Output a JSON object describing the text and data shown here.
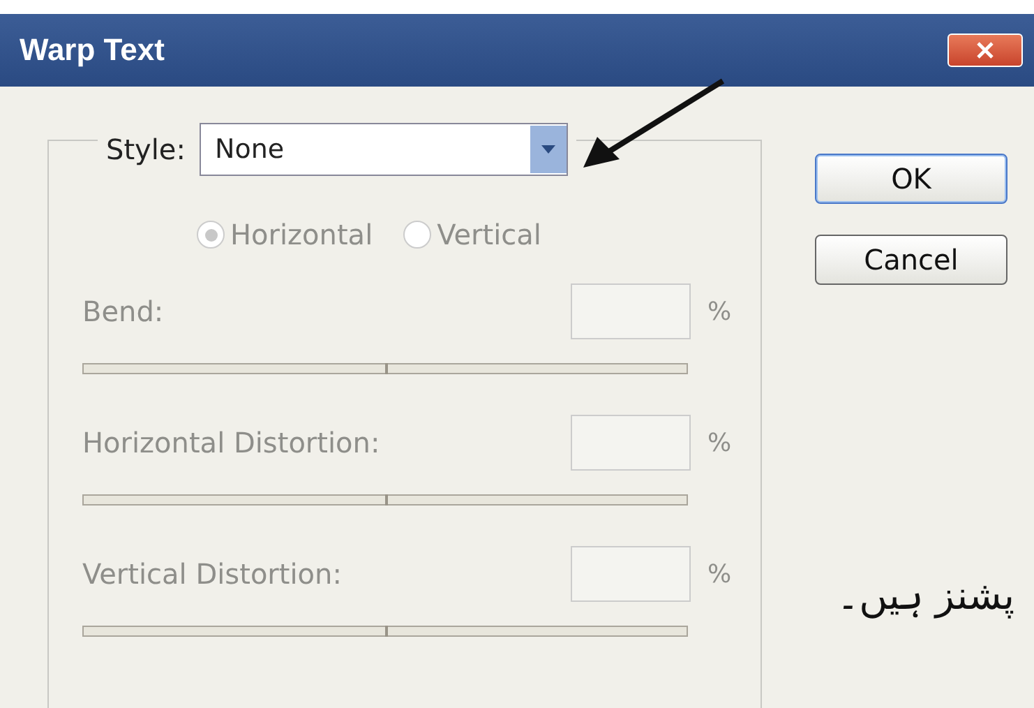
{
  "window": {
    "title": "Warp Text"
  },
  "style": {
    "label": "Style:",
    "value": "None"
  },
  "controls_disabled": true,
  "orientation": [
    {
      "label": "Horizontal",
      "selected": true
    },
    {
      "label": "Vertical",
      "selected": false
    }
  ],
  "sliders": [
    {
      "label": "Bend:",
      "unit": "%",
      "level": 0.5
    },
    {
      "label": "Horizontal Distortion:",
      "unit": "%",
      "level": 0.5
    },
    {
      "label": "Vertical Distortion:",
      "unit": "%",
      "level": 0.5
    }
  ],
  "buttons": [
    {
      "label": "OK",
      "default": true
    },
    {
      "label": "Cancel",
      "default": false
    }
  ],
  "caption": "پشنز ہیں۔"
}
